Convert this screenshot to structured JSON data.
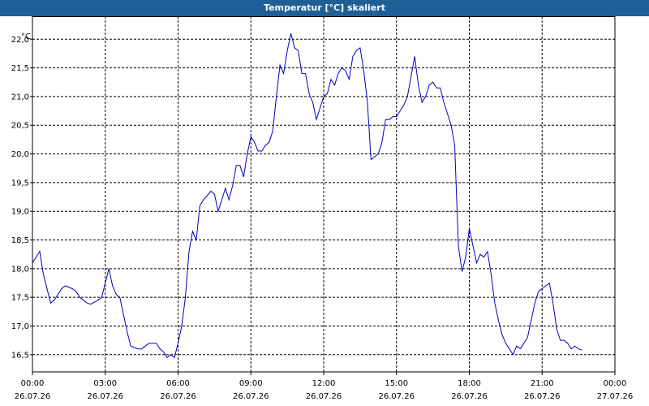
{
  "window": {
    "title": "Temperatur [°C] skaliert"
  },
  "colors": {
    "titlebar": "#1f5f97",
    "series": "#0000c0",
    "grid": "#000000",
    "background": "#ffffff"
  },
  "chart_data": {
    "type": "line",
    "title": "Temperatur [°C] skaliert",
    "ylabel": "°C",
    "xlabel": "",
    "xlim": [
      0,
      24
    ],
    "ylim": [
      16.2,
      22.4
    ],
    "grid": true,
    "yticks": [
      {
        "value": 16.5,
        "label": "16,5"
      },
      {
        "value": 17.0,
        "label": "17,0"
      },
      {
        "value": 17.5,
        "label": "17,5"
      },
      {
        "value": 18.0,
        "label": "18,0"
      },
      {
        "value": 18.5,
        "label": "18,5"
      },
      {
        "value": 19.0,
        "label": "19,0"
      },
      {
        "value": 19.5,
        "label": "19,5"
      },
      {
        "value": 20.0,
        "label": "20,0"
      },
      {
        "value": 20.5,
        "label": "20,5"
      },
      {
        "value": 21.0,
        "label": "21,0"
      },
      {
        "value": 21.5,
        "label": "21,5"
      },
      {
        "value": 22.0,
        "label": "22,0"
      }
    ],
    "xticks": [
      {
        "value": 0,
        "time": "00:00",
        "date": "26.07.26"
      },
      {
        "value": 3,
        "time": "03:00",
        "date": "26.07.26"
      },
      {
        "value": 6,
        "time": "06:00",
        "date": "26.07.26"
      },
      {
        "value": 9,
        "time": "09:00",
        "date": "26.07.26"
      },
      {
        "value": 12,
        "time": "12:00",
        "date": "26.07.26"
      },
      {
        "value": 15,
        "time": "15:00",
        "date": "26.07.26"
      },
      {
        "value": 18,
        "time": "18:00",
        "date": "26.07.26"
      },
      {
        "value": 21,
        "time": "21:00",
        "date": "26.07.26"
      },
      {
        "value": 24,
        "time": "00:00",
        "date": "27.07.26"
      }
    ],
    "x": [
      0.0,
      0.3,
      0.45,
      0.75,
      0.9,
      1.2,
      1.35,
      1.65,
      1.8,
      1.95,
      2.25,
      2.4,
      2.7,
      2.85,
      3.0,
      3.15,
      3.3,
      3.45,
      3.6,
      3.75,
      3.9,
      4.05,
      4.35,
      4.5,
      4.65,
      4.8,
      5.1,
      5.25,
      5.4,
      5.55,
      5.7,
      5.85,
      6.0,
      6.15,
      6.3,
      6.45,
      6.6,
      6.75,
      6.9,
      7.05,
      7.35,
      7.5,
      7.65,
      7.8,
      7.95,
      8.1,
      8.25,
      8.4,
      8.55,
      8.7,
      8.85,
      9.0,
      9.15,
      9.3,
      9.45,
      9.6,
      9.75,
      9.9,
      10.05,
      10.2,
      10.35,
      10.5,
      10.65,
      10.8,
      10.95,
      11.1,
      11.25,
      11.4,
      11.55,
      11.7,
      11.85,
      12.0,
      12.15,
      12.3,
      12.45,
      12.6,
      12.75,
      12.9,
      13.05,
      13.2,
      13.35,
      13.5,
      13.65,
      13.8,
      13.95,
      14.1,
      14.25,
      14.4,
      14.55,
      14.7,
      14.85,
      15.0,
      15.15,
      15.3,
      15.45,
      15.6,
      15.75,
      15.9,
      16.05,
      16.2,
      16.35,
      16.5,
      16.65,
      16.8,
      16.95,
      17.1,
      17.25,
      17.4,
      17.55,
      17.7,
      17.85,
      18.0,
      18.15,
      18.3,
      18.45,
      18.6,
      18.75,
      18.9,
      19.05,
      19.2,
      19.35,
      19.5,
      19.65,
      19.8,
      19.95,
      20.1,
      20.25,
      20.4,
      20.55,
      20.7,
      20.85,
      21.0,
      21.15,
      21.3,
      21.45,
      21.6,
      21.75,
      21.9,
      22.05,
      22.2,
      22.35,
      22.5,
      22.65,
      22.8,
      22.95,
      23.1,
      23.25,
      23.4,
      23.55,
      23.7,
      23.85
    ],
    "series": [
      {
        "values": [
          18.1,
          18.3,
          17.9,
          17.4,
          17.45,
          17.65,
          17.7,
          17.65,
          17.6,
          17.5,
          17.4,
          17.38,
          17.45,
          17.5,
          17.75,
          18.0,
          17.7,
          17.55,
          17.5,
          17.2,
          16.9,
          16.65,
          16.6,
          16.6,
          16.65,
          16.7,
          16.7,
          16.6,
          16.55,
          16.45,
          16.5,
          16.45,
          16.7,
          17.0,
          17.5,
          18.3,
          18.65,
          18.5,
          19.1,
          19.2,
          19.35,
          19.3,
          19.0,
          19.2,
          19.4,
          19.2,
          19.45,
          19.8,
          19.8,
          19.6,
          20.0,
          20.3,
          20.2,
          20.05,
          20.05,
          20.15,
          20.2,
          20.4,
          21.0,
          21.55,
          21.4,
          21.8,
          22.1,
          21.85,
          21.8,
          21.4,
          21.4,
          21.05,
          20.9,
          20.6,
          20.8,
          21.0,
          21.05,
          21.3,
          21.2,
          21.4,
          21.5,
          21.45,
          21.3,
          21.7,
          21.8,
          21.85,
          21.45,
          20.9,
          19.9,
          19.95,
          20.0,
          20.2,
          20.6,
          20.6,
          20.65,
          20.65,
          20.75,
          20.85,
          21.0,
          21.35,
          21.7,
          21.2,
          20.9,
          21.0,
          21.2,
          21.25,
          21.15,
          21.15,
          20.9,
          20.7,
          20.5,
          20.15,
          18.4,
          17.95,
          18.2,
          18.7,
          18.4,
          18.1,
          18.25,
          18.2,
          18.3,
          17.9,
          17.4,
          17.1,
          16.85,
          16.7,
          16.6,
          16.5,
          16.65,
          16.6,
          16.7,
          16.8,
          17.1,
          17.4,
          17.6,
          17.65,
          17.7,
          17.75,
          17.4,
          16.95,
          16.75,
          16.75,
          16.7,
          16.6,
          16.65,
          16.6,
          16.58
        ]
      }
    ]
  }
}
